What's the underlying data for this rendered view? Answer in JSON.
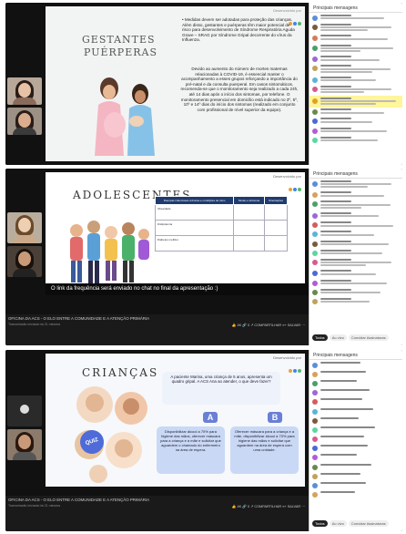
{
  "common": {
    "presenting_label": "Desenvolvido por",
    "chat_title": "Principais mensagens",
    "webinar_title": "OFICINA DA ACS - O ELO ENTRE A COMUNIDADE E A ATENÇÃO PRIMÁRIA",
    "webinar_sub": "Transmissão iniciada há 21 minutos",
    "actions": "👍 4K  🔗 0  ↗ COMPARTILHAR  ≡+ SALVAR  ⋯",
    "tabs": [
      "Todos",
      "Ao vivo",
      "Convidar Assinaturas"
    ]
  },
  "slide1": {
    "title_line1": "GESTANTES",
    "title_line2": "PUÉRPERAS",
    "bullet1": "• Medidas devem ser adotadas para proteção das crianças. Além disso, gestantes e puérperas têm maior potencial de risco para desenvolvimento de Síndrome Respiratória Aguda Grave – SRAG por Síndrome Gripal decorrente do vírus da Influenza.",
    "bullet2": "Devido ao aumento do número de mortes maternas relacionadas à COVID-19, é essencial manter o acompanhamento a esses grupos reforçando a importância do pré-natal e da consulta puerperal. Em casos sintomáticos, recomenda-se que o monitoramento seja realizado a cada 24h, até 14 dias após o início dos sintomas, por telefone. O monitoramento presencial em domicílio está indicado no 3º, 5º, 10º e 14º dias do início dos sintomas (realizado em conjunto com profissional de nível superior da equipe)."
  },
  "slide2": {
    "title": "ADOLESCENTES",
    "table_head": [
      "Doenças infecciosas crônicas e condições de risco",
      "Sinais e sintomas",
      "Orientações"
    ],
    "rows": [
      "Obesidade",
      "Dislipidemia",
      "Diabetes mellitus"
    ],
    "caption": "O link da frequência será enviado no chat no final da apresentação :)"
  },
  "slide3": {
    "title": "CRIANÇAS",
    "question": "A paciente Marina, uma criança de 5 anos, apresenta um quadro gripal. A ACS Ana ao atender, o que deve fazer?",
    "option_a_label": "A",
    "option_a": "Disponibilizar álcool a 70% para higiene das mãos, oferecer máscara para a criança e a mãe e solicitar que aguardem o chamado do enfermeiro na área de espera.",
    "option_b_label": "B",
    "option_b": "Oferecer máscara para a criança e a mãe, disponibilizar álcool a 70% para higiene das mãos e solicitar que aguardem na área de espera com uma unidade.",
    "quiz_label": "QUIZ"
  },
  "colors": {
    "slide1_title": "#6d6d6d",
    "box_a": "#c9d8f5",
    "box_b": "#c9d8f5",
    "badge_a": "#6a7fd6",
    "badge_b": "#6a7fd6",
    "quiz": "#4e6bd9",
    "chat_highlight": "#fff59a",
    "table_header": "#1f3b6f"
  }
}
